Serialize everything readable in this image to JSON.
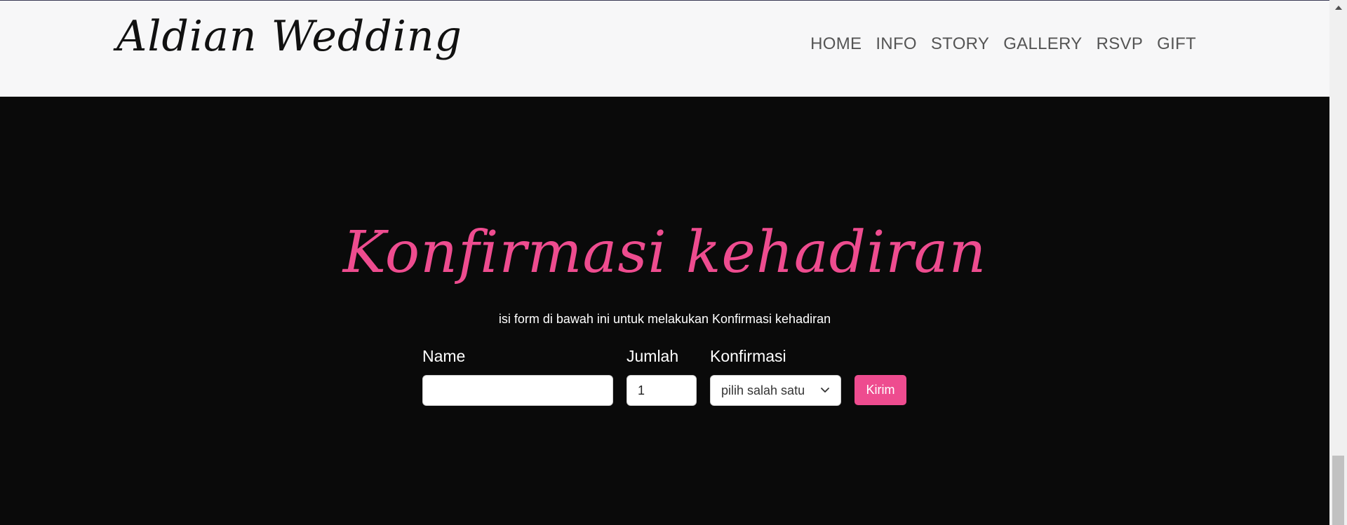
{
  "header": {
    "brand": "Aldian Wedding",
    "nav": [
      "HOME",
      "INFO",
      "STORY",
      "GALLERY",
      "RSVP",
      "GIFT"
    ]
  },
  "rsvp": {
    "title": "Konfirmasi kehadiran",
    "subtitle": "isi form di bawah ini untuk melakukan Konfirmasi kehadiran",
    "labels": {
      "name": "Name",
      "jumlah": "Jumlah",
      "konfirmasi": "Konfirmasi"
    },
    "fields": {
      "name_value": "",
      "jumlah_value": "1",
      "konfirmasi_selected": "pilih salah satu"
    },
    "submit_label": "Kirim"
  },
  "colors": {
    "accent": "#ee4c8f",
    "section_bg": "#0a0a0a",
    "navbar_bg": "#f7f7f8"
  },
  "icons": {
    "select_arrow": "chevron-down-icon",
    "scroll_up": "scroll-up-arrow-icon"
  }
}
